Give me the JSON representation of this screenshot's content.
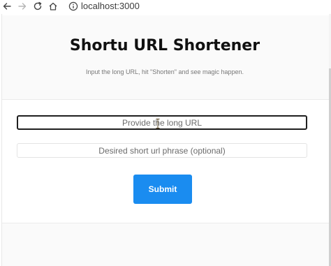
{
  "browser": {
    "url": "localhost:3000"
  },
  "page": {
    "title": "Shortu URL Shortener",
    "subtitle": "Input the long URL, hit \"Shorten\" and see magic happen."
  },
  "form": {
    "long_url_placeholder": "Provide the long URL",
    "long_url_value": "",
    "short_phrase_placeholder": "Desired short url phrase (optional)",
    "short_phrase_value": "",
    "submit_label": "Submit"
  },
  "icons": {
    "back": "back-arrow-icon",
    "forward": "forward-arrow-icon",
    "reload": "reload-icon",
    "home": "home-icon",
    "site_info": "info-icon",
    "text_cursor": "i-beam-cursor-icon"
  },
  "colors": {
    "primary_button": "#1a8cf0",
    "title_text": "#111111",
    "focus_border": "#1f1f1f"
  }
}
